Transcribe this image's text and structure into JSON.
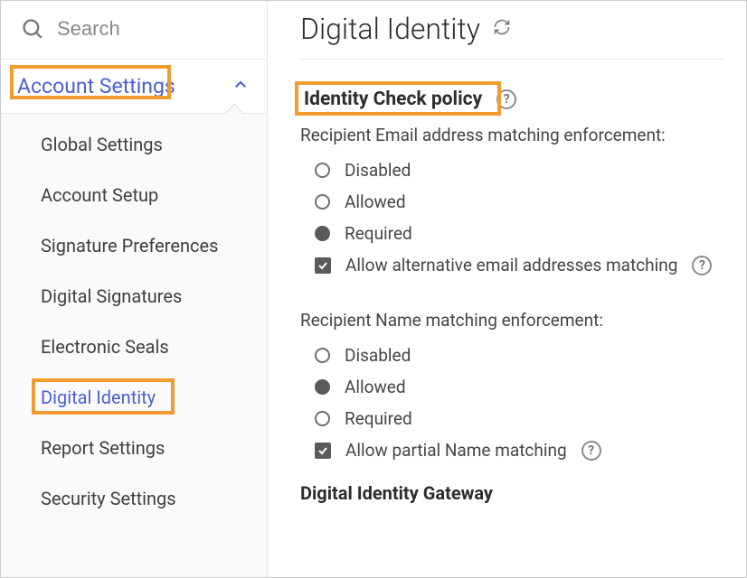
{
  "search": {
    "placeholder": "Search"
  },
  "sidebar": {
    "header": "Account Settings",
    "items": [
      {
        "label": "Global Settings"
      },
      {
        "label": "Account Setup"
      },
      {
        "label": "Signature Preferences"
      },
      {
        "label": "Digital Signatures"
      },
      {
        "label": "Electronic Seals"
      },
      {
        "label": "Digital Identity"
      },
      {
        "label": "Report Settings"
      },
      {
        "label": "Security Settings"
      }
    ]
  },
  "page": {
    "title": "Digital Identity"
  },
  "sections": {
    "identityCheck": {
      "title": "Identity Check policy",
      "emailEnforcement": {
        "label": "Recipient Email address matching enforcement:",
        "options": [
          "Disabled",
          "Allowed",
          "Required"
        ],
        "selected": "Required",
        "allowAltLabel": "Allow alternative email addresses matching",
        "allowAltChecked": true
      },
      "nameEnforcement": {
        "label": "Recipient Name matching enforcement:",
        "options": [
          "Disabled",
          "Allowed",
          "Required"
        ],
        "selected": "Allowed",
        "partialLabel": "Allow partial Name matching",
        "partialChecked": true
      }
    },
    "gateway": {
      "title": "Digital Identity Gateway"
    }
  }
}
